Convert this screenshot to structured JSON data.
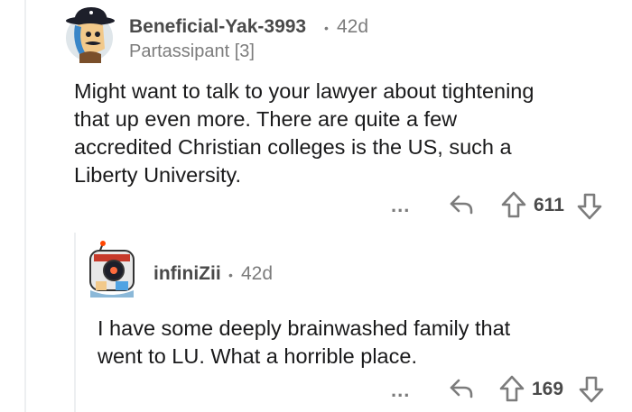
{
  "comment": {
    "username": "Beneficial-Yak-3993",
    "separator": "•",
    "age": "42d",
    "flair": "Partassipant [3]",
    "body_lines": [
      "Might want to talk to your lawyer about tightening",
      "that up even more. There are quite a few",
      "accredited Christian colleges is the US, such a",
      "Liberty University."
    ],
    "more_label": "...",
    "score": "611"
  },
  "reply": {
    "username": "infiniZii",
    "separator": "•",
    "age": "42d",
    "body_lines": [
      "I have some deeply brainwashed family that",
      "went to LU. What a horrible place."
    ],
    "more_label": "...",
    "score": "169"
  },
  "icons": [
    "reply-icon",
    "upvote-icon",
    "downvote-icon",
    "more-icon",
    "avatar"
  ],
  "colors": {
    "text": "#1a1a1b",
    "muted": "#7c7c7c",
    "thread_line": "#edeff1"
  }
}
